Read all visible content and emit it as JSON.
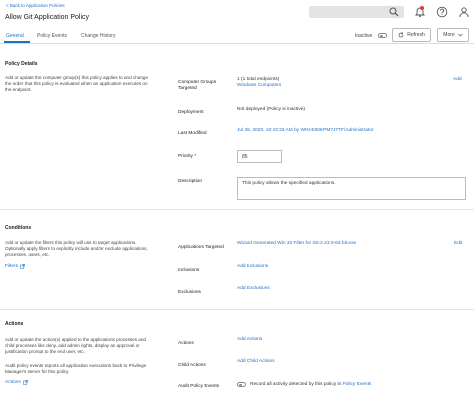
{
  "header": {
    "back_link": "< Back to Application Policies",
    "title": "Allow Git Application Policy"
  },
  "tabs": [
    {
      "label": "General"
    },
    {
      "label": "Policy Events"
    },
    {
      "label": "Change History"
    }
  ],
  "toolbar": {
    "inactive_label": "Inactive",
    "refresh_label": "Refresh",
    "more_label": "More"
  },
  "policy_details": {
    "title": "Policy Details",
    "description": "Add or update the computer group(s) this policy applies to and change the order that this policy is evaluated when an application executes on the endpoint.",
    "computer_groups_label": "Computer Groups Targeted",
    "computer_groups_count": "1 (1 total endpoints)",
    "computer_groups_value": "Windows Computers",
    "add_label": "Add",
    "deployment_label": "Deployment",
    "deployment_value": "Not deployed (Policy is inactive)",
    "last_modified_label": "Last Modified",
    "last_modified_value": "Jul 28, 2020, 10:43:33 AM by WIN-E60KPM7J7TF\\Administrator",
    "priority_label": "Priority *",
    "priority_value": "85",
    "description_label": "Description",
    "description_value": "This policy allows the specified applications."
  },
  "conditions": {
    "title": "Conditions",
    "description": "Add or update the filters this policy will use to target applications. Optionally apply filters to explicitly include and/or exclude applications, processes, users, etc.",
    "filters_link": "Filters",
    "applications_label": "Applications Targeted",
    "applications_value": "Wizard Generated Win 32 Filter for Git-2.23.0-64-bit.exe",
    "edit_label": "Edit",
    "inclusions_label": "Inclusions",
    "inclusions_value": "Add Inclusions",
    "exclusions_label": "Exclusions",
    "exclusions_value": "Add Exclusions"
  },
  "actions": {
    "title": "Actions",
    "description_1": "Add or update the action(s) applied to the applications processes and child processes like deny, add admin rights, display an approval or justification prompt to the end user, etc.",
    "description_2": "Audit policy events reports all application executions back to Privilege Manager's server for this policy.",
    "actions_link": "Actions",
    "actions_label": "Actions",
    "actions_value": "Add Actions",
    "child_actions_label": "Child Actions",
    "child_actions_value": "Add Child Actions",
    "audit_label": "Audit Policy Events",
    "audit_text": "Record all activity detected by this policy in",
    "audit_link": "Policy Events"
  }
}
